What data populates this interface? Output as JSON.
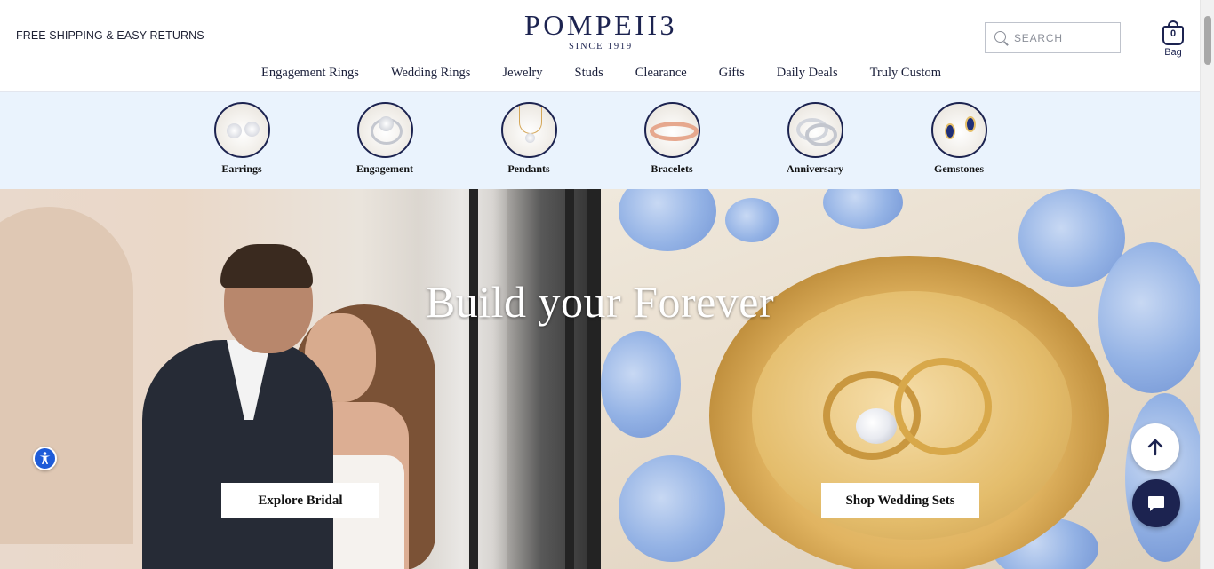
{
  "header": {
    "promo": "FREE SHIPPING & EASY RETURNS",
    "logo_word": "POMPEII3",
    "logo_sub": "SINCE 1919",
    "search_placeholder": "SEARCH",
    "bag_count": "0",
    "bag_label": "Bag"
  },
  "nav": {
    "items": [
      "Engagement Rings",
      "Wedding Rings",
      "Jewelry",
      "Studs",
      "Clearance",
      "Gifts",
      "Daily Deals",
      "Truly Custom"
    ]
  },
  "categories": [
    {
      "label": "Earrings",
      "icon": "earrings-icon"
    },
    {
      "label": "Engagement",
      "icon": "engagement-ring-icon"
    },
    {
      "label": "Pendants",
      "icon": "pendant-icon"
    },
    {
      "label": "Bracelets",
      "icon": "bracelet-icon"
    },
    {
      "label": "Anniversary",
      "icon": "anniversary-band-icon"
    },
    {
      "label": "Gemstones",
      "icon": "gemstone-earrings-icon"
    }
  ],
  "hero": {
    "title": "Build your Forever",
    "cta_left": "Explore Bridal",
    "cta_right": "Shop Wedding Sets"
  },
  "colors": {
    "brand_navy": "#1c2350",
    "category_strip_bg": "#eaf3fd",
    "accessibility_blue": "#1d5bd8"
  },
  "widgets": {
    "accessibility": "accessibility-icon",
    "scroll_top": "arrow-up-icon",
    "chat": "chat-bubble-icon"
  }
}
